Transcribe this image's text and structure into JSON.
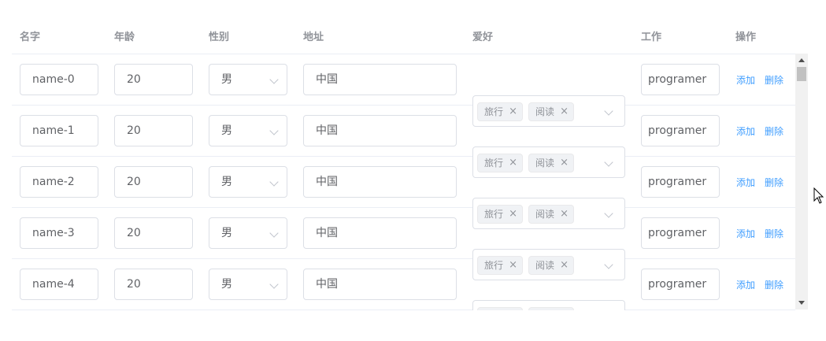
{
  "table": {
    "headers": {
      "name": "名字",
      "age": "年龄",
      "gender": "性别",
      "address": "地址",
      "hobby": "爱好",
      "job": "工作",
      "actions": "操作"
    },
    "rows": [
      {
        "name": "name-0",
        "age": "20",
        "gender": "男",
        "address": "中国",
        "hobbies": [
          "旅行",
          "阅读"
        ],
        "job": "programer",
        "add_label": "添加",
        "delete_label": "删除"
      },
      {
        "name": "name-1",
        "age": "20",
        "gender": "男",
        "address": "中国",
        "hobbies": [
          "旅行",
          "阅读"
        ],
        "job": "programer",
        "add_label": "添加",
        "delete_label": "删除"
      },
      {
        "name": "name-2",
        "age": "20",
        "gender": "男",
        "address": "中国",
        "hobbies": [
          "旅行",
          "阅读"
        ],
        "job": "programer",
        "add_label": "添加",
        "delete_label": "删除"
      },
      {
        "name": "name-3",
        "age": "20",
        "gender": "男",
        "address": "中国",
        "hobbies": [
          "旅行",
          "阅读"
        ],
        "job": "programer",
        "add_label": "添加",
        "delete_label": "删除"
      },
      {
        "name": "name-4",
        "age": "20",
        "gender": "男",
        "address": "中国",
        "hobbies": [
          "旅行",
          "阅读"
        ],
        "job": "programer",
        "add_label": "添加",
        "delete_label": "删除"
      }
    ]
  },
  "icons": {
    "tag_close": "close-icon",
    "select_arrow": "chevron-down-icon",
    "scroll_up": "triangle-up-icon",
    "scroll_down": "triangle-down-icon"
  },
  "colors": {
    "link": "#409eff",
    "header_text": "#909399",
    "border": "#dcdfe6",
    "tag_bg": "#f0f2f5"
  }
}
